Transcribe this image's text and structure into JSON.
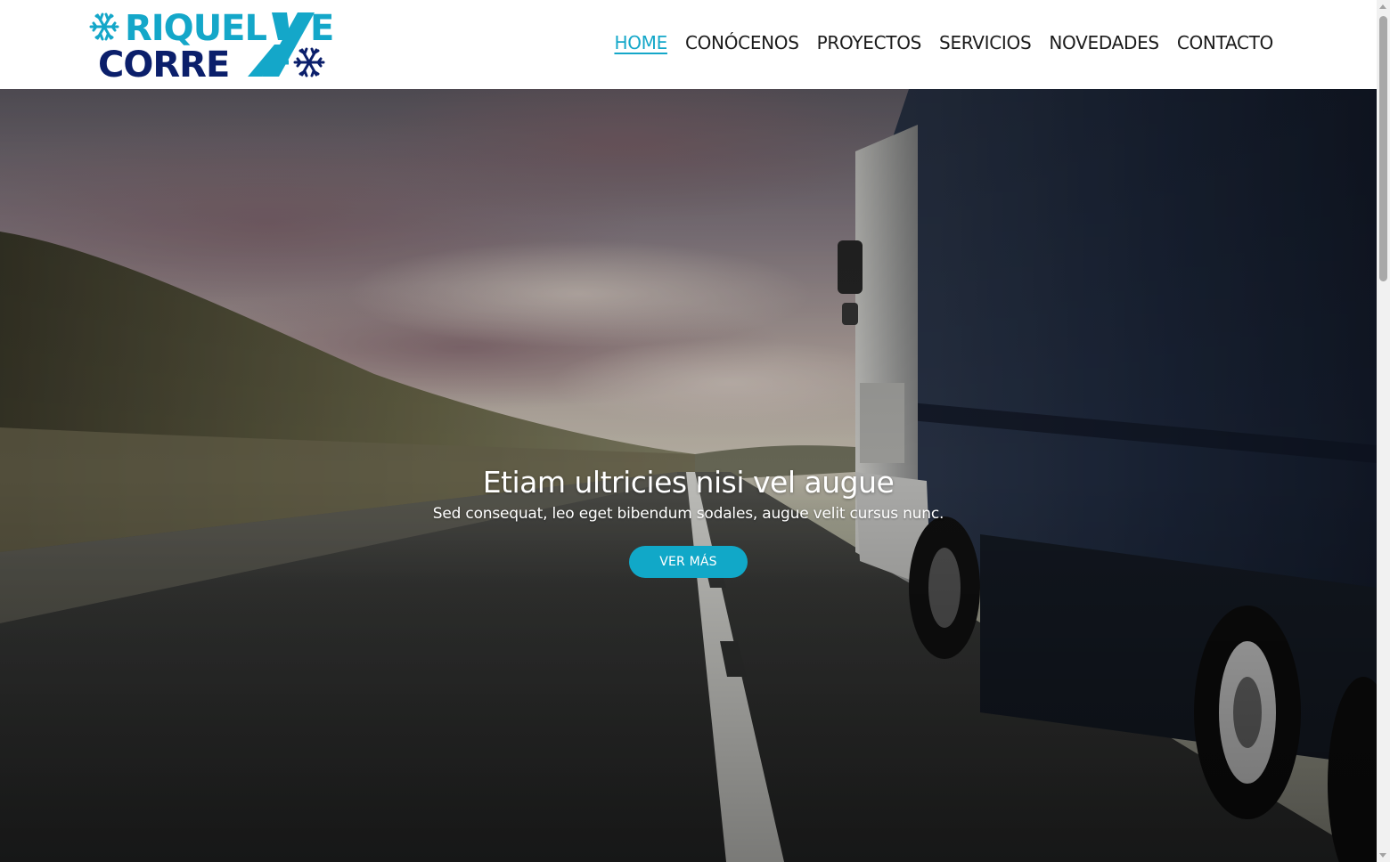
{
  "brand": {
    "line1": "RIQUELME",
    "line2": "CORREA",
    "colors": {
      "cyan": "#14a7c9",
      "navy": "#0b1f6b"
    },
    "icon": "snowflake-icon"
  },
  "nav": {
    "items": [
      {
        "label": "HOME",
        "active": true
      },
      {
        "label": "CONÓCENOS",
        "active": false
      },
      {
        "label": "PROYECTOS",
        "active": false
      },
      {
        "label": "SERVICIOS",
        "active": false
      },
      {
        "label": "NOVEDADES",
        "active": false
      },
      {
        "label": "CONTACTO",
        "active": false
      }
    ],
    "active_color": "#14a7c9"
  },
  "hero": {
    "title": "Etiam ultricies nisi vel augue",
    "subtitle": "Sed consequat, leo eget bibendum sodales, augue velit cursus nunc.",
    "button_label": "VER MÁS",
    "button_color": "#11a8c8"
  }
}
